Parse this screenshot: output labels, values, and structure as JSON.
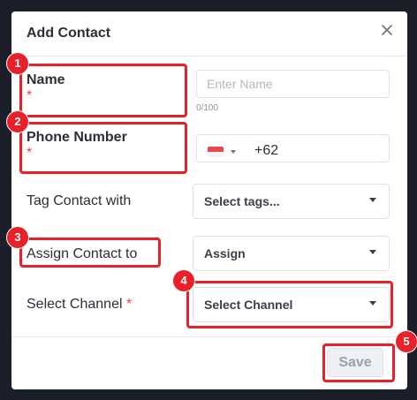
{
  "modal": {
    "title": "Add Contact",
    "close_icon": "close-icon"
  },
  "form": {
    "name": {
      "label": "Name",
      "required_mark": "*",
      "placeholder": "Enter Name",
      "value": "",
      "counter": "0/100"
    },
    "phone": {
      "label": "Phone Number",
      "required_mark": "*",
      "country_flag": "indonesia-flag-icon",
      "dial_code": "+62",
      "flag_colors": [
        "#e5484d",
        "#f3f3f3"
      ]
    },
    "tag": {
      "label": "Tag Contact with",
      "selected": "Select tags..."
    },
    "assign": {
      "label": "Assign Contact to",
      "selected": "Assign"
    },
    "channel": {
      "label": "Select Channel",
      "required_mark": "*",
      "selected": "Select Channel"
    }
  },
  "footer": {
    "save_label": "Save"
  },
  "annotations": {
    "badges": [
      "1",
      "2",
      "3",
      "4",
      "5"
    ],
    "color": "#e8202a"
  }
}
